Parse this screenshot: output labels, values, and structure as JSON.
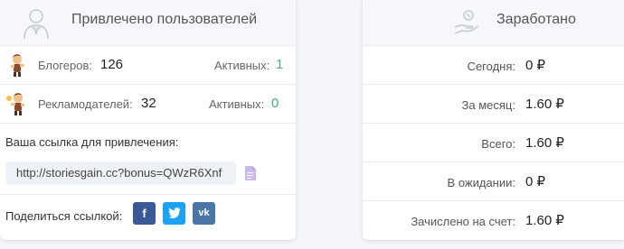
{
  "referrals": {
    "title": "Привлечено пользователей",
    "bloggers": {
      "label": "Блогеров:",
      "count": "126",
      "active_label": "Активных:",
      "active_count": "1"
    },
    "advertisers": {
      "label": "Рекламодателей:",
      "count": "32",
      "active_label": "Активных:",
      "active_count": "0"
    },
    "ref_link_label": "Ваша ссылка для привлечения:",
    "ref_link": "http://storiesgain.cc?bonus=QWzR6Xnf",
    "share_label": "Поделиться ссылкой:",
    "share_buttons": [
      {
        "name": "facebook",
        "glyph": "f",
        "color": "#3b5998"
      },
      {
        "name": "twitter",
        "glyph": "t",
        "color": "#1da1f2"
      },
      {
        "name": "vk",
        "glyph": "vk",
        "color": "#4a76a8"
      }
    ]
  },
  "earnings": {
    "title": "Заработано",
    "rows": [
      {
        "label": "Сегодня:",
        "value": "0 ₽"
      },
      {
        "label": "За месяц:",
        "value": "1.60 ₽"
      },
      {
        "label": "Всего:",
        "value": "1.60 ₽"
      },
      {
        "label": "В ожидании:",
        "value": "0 ₽"
      },
      {
        "label": "Зачислено на счет:",
        "value": "1.60 ₽"
      }
    ]
  },
  "colors": {
    "active_green": "#4caf7a",
    "header_bg": "#f5f7fb"
  }
}
